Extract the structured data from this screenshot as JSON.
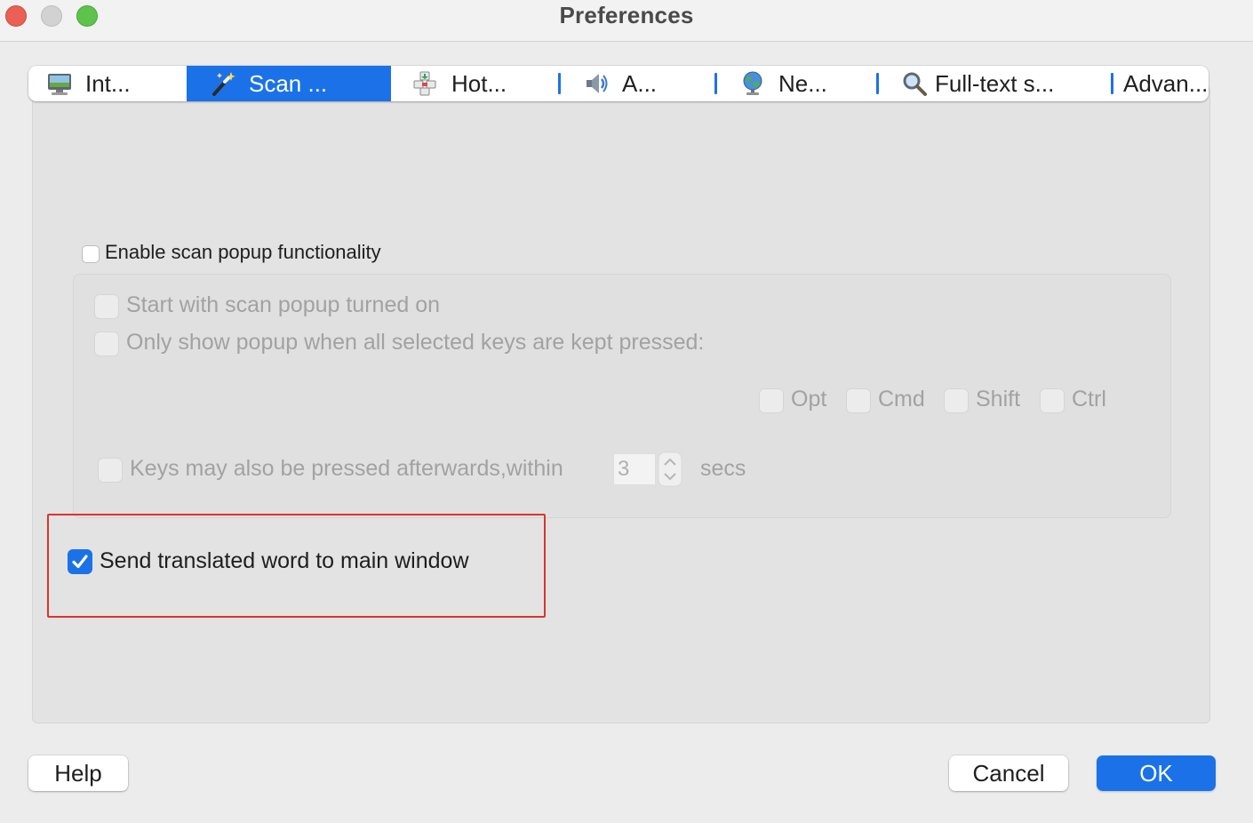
{
  "window": {
    "title": "Preferences"
  },
  "tabs": [
    {
      "label": "Int...",
      "icon": "monitor-icon",
      "active": false
    },
    {
      "label": "Scan ...",
      "icon": "magic-wand-icon",
      "active": true
    },
    {
      "label": "Hot...",
      "icon": "hotkeys-icon",
      "active": false
    },
    {
      "label": "A...",
      "icon": "speaker-icon",
      "active": false
    },
    {
      "label": "Ne...",
      "icon": "globe-icon",
      "active": false
    },
    {
      "label": "Full-text s...",
      "icon": "magnifier-icon",
      "active": false
    },
    {
      "label": "Advan...",
      "icon": "",
      "active": false
    }
  ],
  "scan": {
    "enable_label": "Enable scan popup functionality",
    "enable_checked": false,
    "start_on_label": "Start with scan popup turned on",
    "only_show_label": "Only show popup when all selected keys are kept pressed:",
    "keys": [
      "Opt",
      "Cmd",
      "Shift",
      "Ctrl"
    ],
    "afterwards_label": "Keys may also be pressed afterwards,within",
    "afterwards_value": "3",
    "afterwards_unit": "secs",
    "send_label": "Send translated word to main window",
    "send_checked": true
  },
  "buttons": {
    "help": "Help",
    "cancel": "Cancel",
    "ok": "OK"
  },
  "colors": {
    "accent": "#1b72e8",
    "highlight": "#d9362b"
  }
}
